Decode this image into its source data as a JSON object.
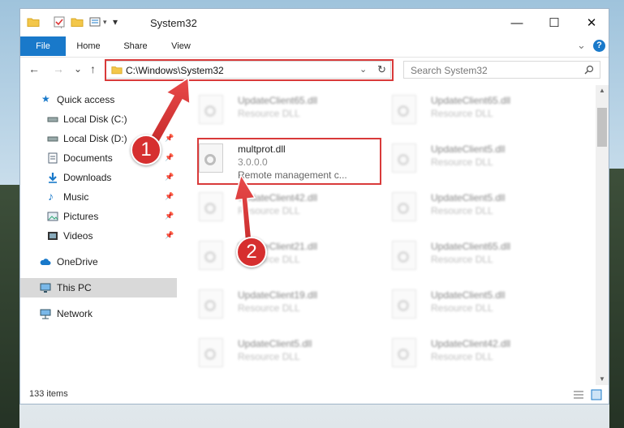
{
  "window": {
    "title": "System32",
    "controls": {
      "minimize": "—",
      "maximize": "☐",
      "close": "✕"
    }
  },
  "ribbon": {
    "tabs": [
      "File",
      "Home",
      "Share",
      "View"
    ],
    "help": "?",
    "collapse": "⌄"
  },
  "navigation": {
    "back": "←",
    "forward": "→",
    "recent": "⌄",
    "up": "↑",
    "address": "C:\\Windows\\System32",
    "refresh": "↻",
    "search_placeholder": "Search System32"
  },
  "sidebar": {
    "items": [
      {
        "label": "Quick access",
        "icon": "star-icon",
        "pinned": false
      },
      {
        "label": "Local Disk (C:)",
        "icon": "drive-icon",
        "pinned": true
      },
      {
        "label": "Local Disk (D:)",
        "icon": "drive-icon",
        "pinned": true
      },
      {
        "label": "Documents",
        "icon": "documents-icon",
        "pinned": true
      },
      {
        "label": "Downloads",
        "icon": "download-icon",
        "pinned": true
      },
      {
        "label": "Music",
        "icon": "music-icon",
        "pinned": true
      },
      {
        "label": "Pictures",
        "icon": "pictures-icon",
        "pinned": true
      },
      {
        "label": "Videos",
        "icon": "video-icon",
        "pinned": true
      },
      {
        "label": "OneDrive",
        "icon": "cloud-icon",
        "pinned": false
      },
      {
        "label": "This PC",
        "icon": "computer-icon",
        "pinned": false,
        "selected": true
      },
      {
        "label": "Network",
        "icon": "network-icon",
        "pinned": false
      }
    ]
  },
  "files": {
    "highlighted": {
      "name": "multprot.dll",
      "version": "3.0.0.0",
      "description": "Remote management c..."
    },
    "left_column": [
      {
        "name": "UpdateClient65.dll",
        "type": "Resource DLL"
      },
      {
        "name": "UpdateClient42.dll",
        "type": "Resource DLL"
      },
      {
        "name": "UpdateClient21.dll",
        "type": "Resource DLL"
      },
      {
        "name": "UpdateClient19.dll",
        "type": "Resource DLL"
      },
      {
        "name": "UpdateClient5.dll",
        "type": "Resource DLL"
      }
    ],
    "right_column": [
      {
        "name": "UpdateClient65.dll",
        "type": "Resource DLL"
      },
      {
        "name": "UpdateClient5.dll",
        "type": "Resource DLL"
      },
      {
        "name": "UpdateClient5.dll",
        "type": "Resource DLL"
      },
      {
        "name": "UpdateClient65.dll",
        "type": "Resource DLL"
      },
      {
        "name": "UpdateClient5.dll",
        "type": "Resource DLL"
      },
      {
        "name": "UpdateClient42.dll",
        "type": "Resource DLL"
      }
    ]
  },
  "status": {
    "item_count": "133 items"
  },
  "annotations": {
    "step1": "1",
    "step2": "2"
  },
  "colors": {
    "accent": "#1979ca",
    "highlight_box": "#d93a3a",
    "badge": "#d62f2f"
  }
}
